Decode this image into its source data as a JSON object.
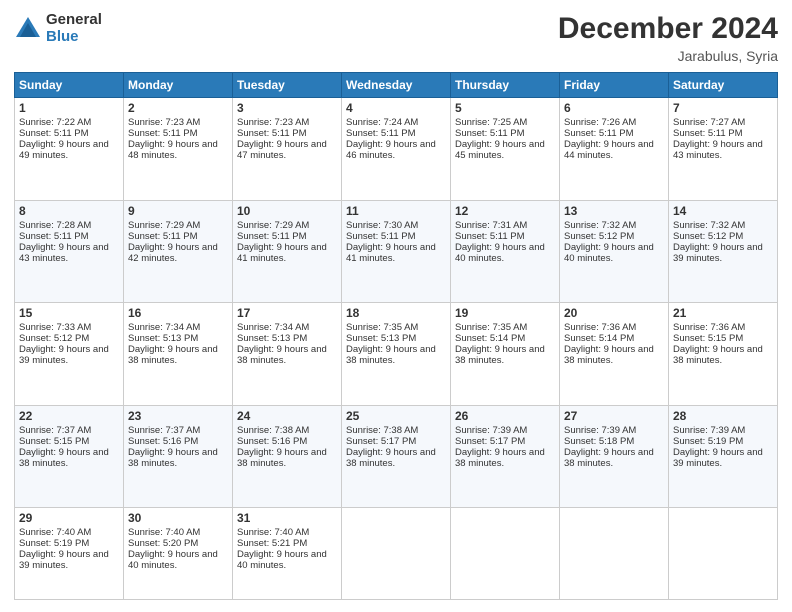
{
  "header": {
    "logo_general": "General",
    "logo_blue": "Blue",
    "month_title": "December 2024",
    "location": "Jarabulus, Syria"
  },
  "weekdays": [
    "Sunday",
    "Monday",
    "Tuesday",
    "Wednesday",
    "Thursday",
    "Friday",
    "Saturday"
  ],
  "weeks": [
    [
      {
        "day": "1",
        "sunrise": "7:22 AM",
        "sunset": "5:11 PM",
        "daylight": "9 hours and 49 minutes."
      },
      {
        "day": "2",
        "sunrise": "7:23 AM",
        "sunset": "5:11 PM",
        "daylight": "9 hours and 48 minutes."
      },
      {
        "day": "3",
        "sunrise": "7:23 AM",
        "sunset": "5:11 PM",
        "daylight": "9 hours and 47 minutes."
      },
      {
        "day": "4",
        "sunrise": "7:24 AM",
        "sunset": "5:11 PM",
        "daylight": "9 hours and 46 minutes."
      },
      {
        "day": "5",
        "sunrise": "7:25 AM",
        "sunset": "5:11 PM",
        "daylight": "9 hours and 45 minutes."
      },
      {
        "day": "6",
        "sunrise": "7:26 AM",
        "sunset": "5:11 PM",
        "daylight": "9 hours and 44 minutes."
      },
      {
        "day": "7",
        "sunrise": "7:27 AM",
        "sunset": "5:11 PM",
        "daylight": "9 hours and 43 minutes."
      }
    ],
    [
      {
        "day": "8",
        "sunrise": "7:28 AM",
        "sunset": "5:11 PM",
        "daylight": "9 hours and 43 minutes."
      },
      {
        "day": "9",
        "sunrise": "7:29 AM",
        "sunset": "5:11 PM",
        "daylight": "9 hours and 42 minutes."
      },
      {
        "day": "10",
        "sunrise": "7:29 AM",
        "sunset": "5:11 PM",
        "daylight": "9 hours and 41 minutes."
      },
      {
        "day": "11",
        "sunrise": "7:30 AM",
        "sunset": "5:11 PM",
        "daylight": "9 hours and 41 minutes."
      },
      {
        "day": "12",
        "sunrise": "7:31 AM",
        "sunset": "5:11 PM",
        "daylight": "9 hours and 40 minutes."
      },
      {
        "day": "13",
        "sunrise": "7:32 AM",
        "sunset": "5:12 PM",
        "daylight": "9 hours and 40 minutes."
      },
      {
        "day": "14",
        "sunrise": "7:32 AM",
        "sunset": "5:12 PM",
        "daylight": "9 hours and 39 minutes."
      }
    ],
    [
      {
        "day": "15",
        "sunrise": "7:33 AM",
        "sunset": "5:12 PM",
        "daylight": "9 hours and 39 minutes."
      },
      {
        "day": "16",
        "sunrise": "7:34 AM",
        "sunset": "5:13 PM",
        "daylight": "9 hours and 38 minutes."
      },
      {
        "day": "17",
        "sunrise": "7:34 AM",
        "sunset": "5:13 PM",
        "daylight": "9 hours and 38 minutes."
      },
      {
        "day": "18",
        "sunrise": "7:35 AM",
        "sunset": "5:13 PM",
        "daylight": "9 hours and 38 minutes."
      },
      {
        "day": "19",
        "sunrise": "7:35 AM",
        "sunset": "5:14 PM",
        "daylight": "9 hours and 38 minutes."
      },
      {
        "day": "20",
        "sunrise": "7:36 AM",
        "sunset": "5:14 PM",
        "daylight": "9 hours and 38 minutes."
      },
      {
        "day": "21",
        "sunrise": "7:36 AM",
        "sunset": "5:15 PM",
        "daylight": "9 hours and 38 minutes."
      }
    ],
    [
      {
        "day": "22",
        "sunrise": "7:37 AM",
        "sunset": "5:15 PM",
        "daylight": "9 hours and 38 minutes."
      },
      {
        "day": "23",
        "sunrise": "7:37 AM",
        "sunset": "5:16 PM",
        "daylight": "9 hours and 38 minutes."
      },
      {
        "day": "24",
        "sunrise": "7:38 AM",
        "sunset": "5:16 PM",
        "daylight": "9 hours and 38 minutes."
      },
      {
        "day": "25",
        "sunrise": "7:38 AM",
        "sunset": "5:17 PM",
        "daylight": "9 hours and 38 minutes."
      },
      {
        "day": "26",
        "sunrise": "7:39 AM",
        "sunset": "5:17 PM",
        "daylight": "9 hours and 38 minutes."
      },
      {
        "day": "27",
        "sunrise": "7:39 AM",
        "sunset": "5:18 PM",
        "daylight": "9 hours and 38 minutes."
      },
      {
        "day": "28",
        "sunrise": "7:39 AM",
        "sunset": "5:19 PM",
        "daylight": "9 hours and 39 minutes."
      }
    ],
    [
      {
        "day": "29",
        "sunrise": "7:40 AM",
        "sunset": "5:19 PM",
        "daylight": "9 hours and 39 minutes."
      },
      {
        "day": "30",
        "sunrise": "7:40 AM",
        "sunset": "5:20 PM",
        "daylight": "9 hours and 40 minutes."
      },
      {
        "day": "31",
        "sunrise": "7:40 AM",
        "sunset": "5:21 PM",
        "daylight": "9 hours and 40 minutes."
      },
      null,
      null,
      null,
      null
    ]
  ]
}
